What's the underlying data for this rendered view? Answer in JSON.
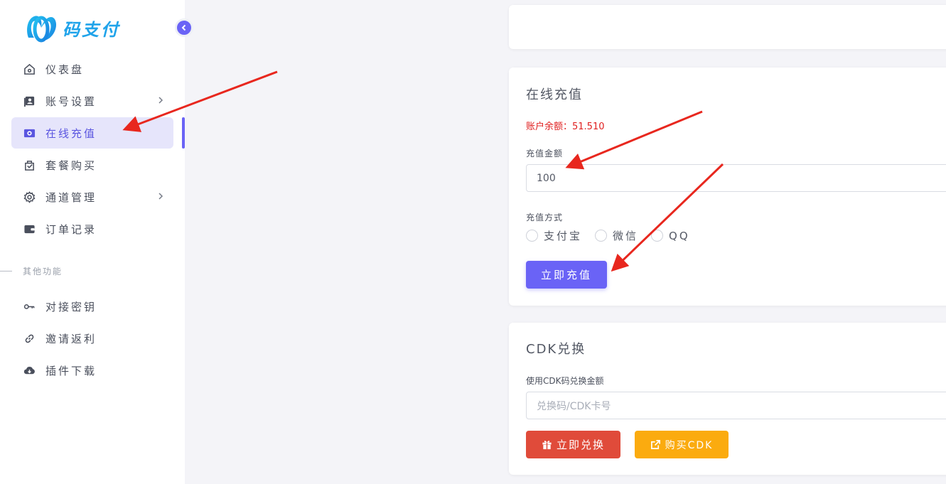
{
  "brand": {
    "name": "码支付"
  },
  "sidebar": {
    "items": [
      {
        "label": "仪表盘",
        "icon": "home-icon"
      },
      {
        "label": "账号设置",
        "icon": "account-icon",
        "has_children": true
      },
      {
        "label": "在线充值",
        "icon": "recharge-icon",
        "active": true
      },
      {
        "label": "套餐购买",
        "icon": "package-icon"
      },
      {
        "label": "通道管理",
        "icon": "gear-icon",
        "has_children": true
      },
      {
        "label": "订单记录",
        "icon": "wallet-icon"
      }
    ],
    "section_label": "其他功能",
    "items2": [
      {
        "label": "对接密钥",
        "icon": "key-icon"
      },
      {
        "label": "邀请返利",
        "icon": "link-icon"
      },
      {
        "label": "插件下载",
        "icon": "cloud-download-icon"
      }
    ]
  },
  "recharge": {
    "title": "在线充值",
    "balance": "账户余额：51.510",
    "amount_label": "充值金额",
    "amount_value": "100",
    "method_label": "充值方式",
    "methods": [
      "支付宝",
      "微信",
      "QQ"
    ],
    "submit_label": "立即充值"
  },
  "cdk": {
    "title": "CDK兑换",
    "field_label": "使用CDK码兑换金额",
    "placeholder": "兑换码/CDK卡号",
    "redeem_label": "立即兑换",
    "buy_label": "购买CDK"
  },
  "colors": {
    "accent": "#6a63f6",
    "active_bg": "#e6e5fb",
    "balance": "#e02020",
    "redeem": "#e04b3a",
    "buy": "#fbab0f",
    "arrow": "#e8271e"
  }
}
